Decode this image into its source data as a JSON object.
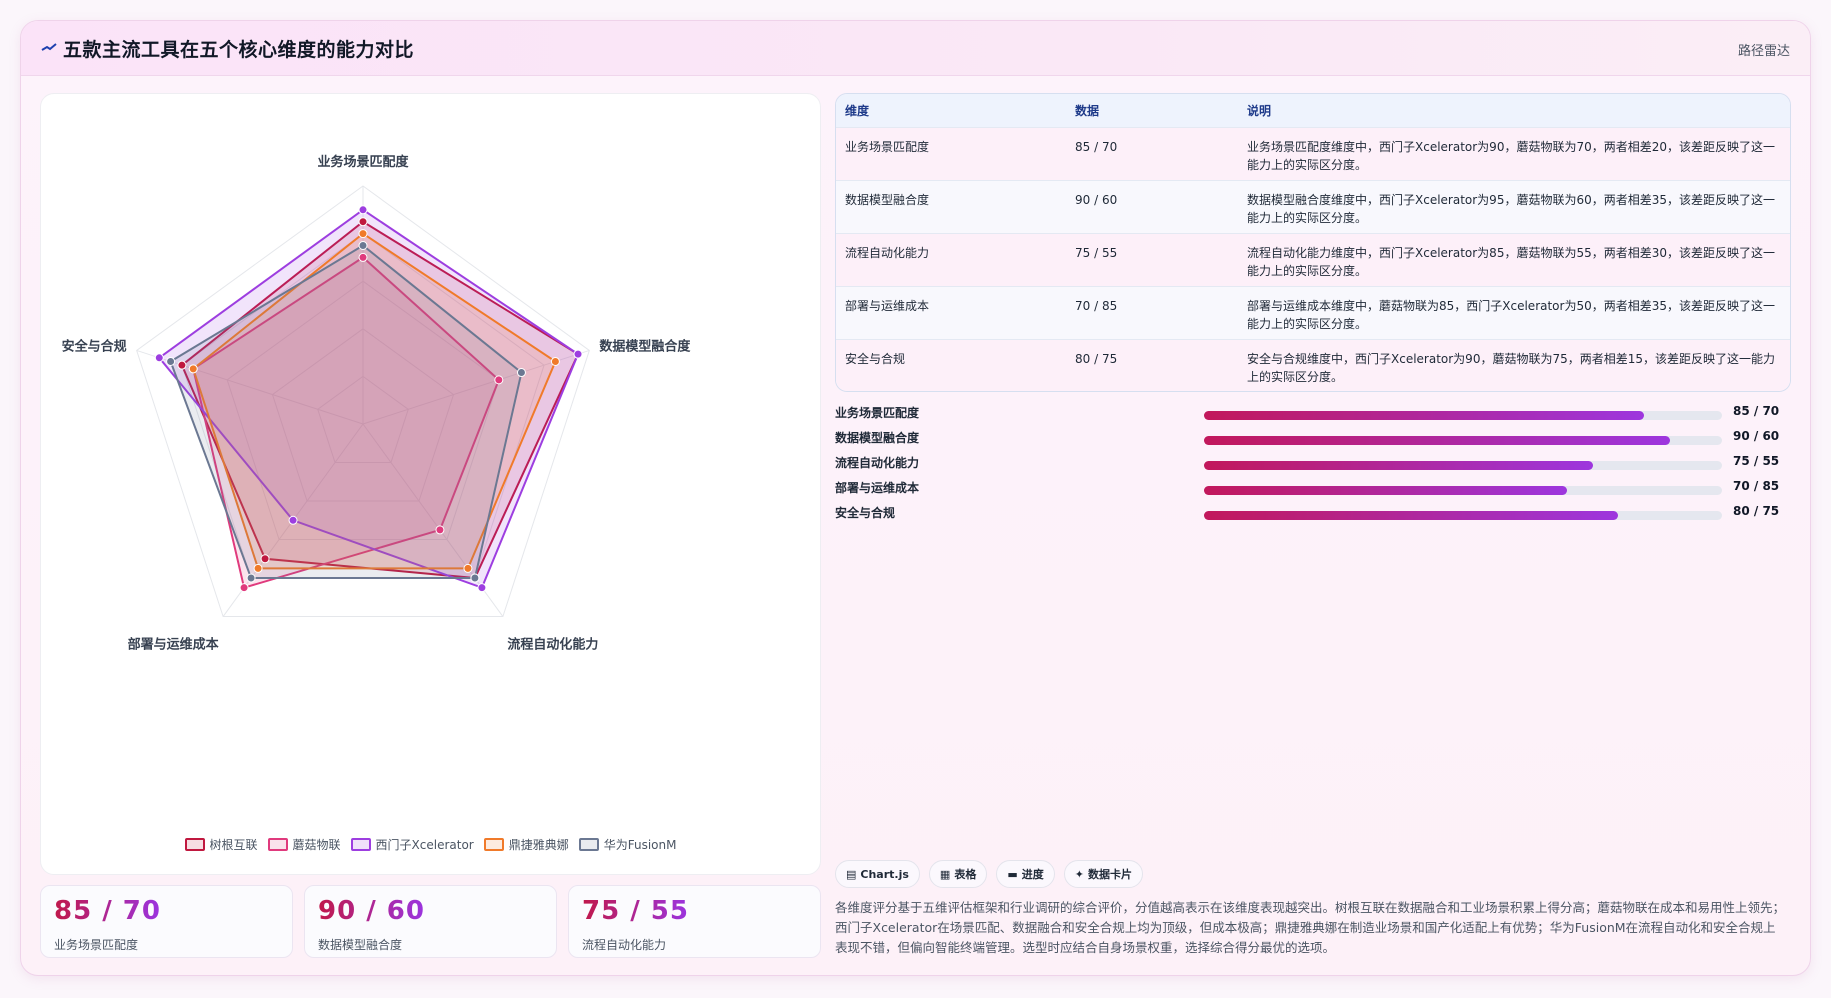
{
  "header": {
    "title": "五款主流工具在五个核心维度的能力对比",
    "tag": "路径雷达"
  },
  "chart_data": {
    "type": "radar",
    "axes": [
      "业务场景匹配度",
      "数据模型融合度",
      "流程自动化能力",
      "部署与运维成本",
      "安全与合规"
    ],
    "range": [
      0,
      100
    ],
    "series": [
      {
        "name": "树根互联",
        "values": [
          85,
          95,
          80,
          70,
          80
        ],
        "color": "#c0183f"
      },
      {
        "name": "蘑菇物联",
        "values": [
          70,
          60,
          55,
          85,
          75
        ],
        "color": "#e03a7d"
      },
      {
        "name": "西门子Xcelerator",
        "values": [
          90,
          95,
          85,
          50,
          90
        ],
        "color": "#9d3ee0"
      },
      {
        "name": "鼎捷雅典娜",
        "values": [
          80,
          85,
          75,
          75,
          75
        ],
        "color": "#f07a2a"
      },
      {
        "name": "华为FusionM",
        "values": [
          75,
          70,
          80,
          80,
          85
        ],
        "color": "#6b7892"
      }
    ],
    "legend_position": "bottom"
  },
  "stats": [
    {
      "value": "85 / 70",
      "label": "业务场景匹配度"
    },
    {
      "value": "90 / 60",
      "label": "数据模型融合度"
    },
    {
      "value": "75 / 55",
      "label": "流程自动化能力"
    }
  ],
  "table": {
    "headers": [
      "维度",
      "数据",
      "说明"
    ],
    "rows": [
      [
        "业务场景匹配度",
        "85 / 70",
        "业务场景匹配度维度中，西门子Xcelerator为90，蘑菇物联为70，两者相差20，该差距反映了这一能力上的实际区分度。"
      ],
      [
        "数据模型融合度",
        "90 / 60",
        "数据模型融合度维度中，西门子Xcelerator为95，蘑菇物联为60，两者相差35，该差距反映了这一能力上的实际区分度。"
      ],
      [
        "流程自动化能力",
        "75 / 55",
        "流程自动化能力维度中，西门子Xcelerator为85，蘑菇物联为55，两者相差30，该差距反映了这一能力上的实际区分度。"
      ],
      [
        "部署与运维成本",
        "70 / 85",
        "部署与运维成本维度中，蘑菇物联为85，西门子Xcelerator为50，两者相差35，该差距反映了这一能力上的实际区分度。"
      ],
      [
        "安全与合规",
        "80 / 75",
        "安全与合规维度中，西门子Xcelerator为90，蘑菇物联为75，两者相差15，该差距反映了这一能力上的实际区分度。"
      ]
    ]
  },
  "progress": [
    {
      "label": "业务场景匹配度",
      "value": "85 / 70",
      "fill": 0.85
    },
    {
      "label": "数据模型融合度",
      "value": "90 / 60",
      "fill": 0.9
    },
    {
      "label": "流程自动化能力",
      "value": "75 / 55",
      "fill": 0.75
    },
    {
      "label": "部署与运维成本",
      "value": "70 / 85",
      "fill": 0.7
    },
    {
      "label": "安全与合规",
      "value": "80 / 75",
      "fill": 0.8
    }
  ],
  "chips": [
    {
      "icon": "chart-icon",
      "glyph": "▤",
      "label": "Chart.js"
    },
    {
      "icon": "table-icon",
      "glyph": "▦",
      "label": "表格"
    },
    {
      "icon": "progress-icon",
      "glyph": "▬",
      "label": "进度"
    },
    {
      "icon": "card-icon",
      "glyph": "✦",
      "label": "数据卡片"
    }
  ],
  "note": "各维度评分基于五维评估框架和行业调研的综合评价，分值越高表示在该维度表现越突出。树根互联在数据融合和工业场景积累上得分高；蘑菇物联在成本和易用性上领先；西门子Xcelerator在场景匹配、数据融合和安全合规上均为顶级，但成本极高；鼎捷雅典娜在制造业场景和国产化适配上有优势；华为FusionM在流程自动化和安全合规上表现不错，但偏向智能终端管理。选型时应结合自身场景权重，选择综合得分最优的选项。"
}
